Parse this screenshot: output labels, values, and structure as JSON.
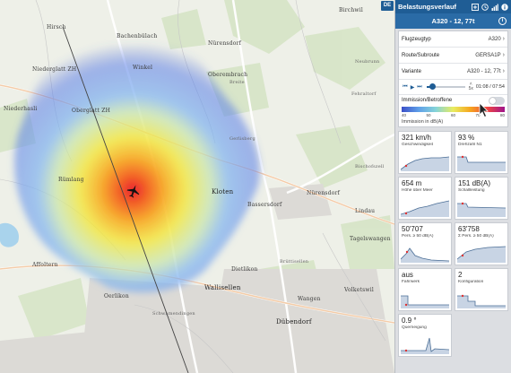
{
  "map": {
    "places": [
      {
        "name": "Hirsch",
        "cls": "small"
      },
      {
        "name": "Bachenbülach",
        "cls": ""
      },
      {
        "name": "Nürensdorf",
        "cls": ""
      },
      {
        "name": "Birchwil",
        "cls": "small"
      },
      {
        "name": "Niederglatt ZH",
        "cls": ""
      },
      {
        "name": "Winkel",
        "cls": ""
      },
      {
        "name": "Oberembrach",
        "cls": "small"
      },
      {
        "name": "Breite",
        "cls": "small"
      },
      {
        "name": "Oberglatt ZH",
        "cls": ""
      },
      {
        "name": "Niederhasli",
        "cls": ""
      },
      {
        "name": "Rümlang",
        "cls": ""
      },
      {
        "name": "Gerlisberg",
        "cls": "small"
      },
      {
        "name": "Kloten",
        "cls": "big"
      },
      {
        "name": "Bassersdorf",
        "cls": ""
      },
      {
        "name": "Nürensdorf",
        "cls": ""
      },
      {
        "name": "Lindau",
        "cls": ""
      },
      {
        "name": "Tagelswangen",
        "cls": ""
      },
      {
        "name": "Dietlikon",
        "cls": ""
      },
      {
        "name": "Wallisellen",
        "cls": "big"
      },
      {
        "name": "Brüttisellen",
        "cls": "small"
      },
      {
        "name": "Affoltern",
        "cls": ""
      },
      {
        "name": "Oerlikon",
        "cls": ""
      },
      {
        "name": "Dübendorf",
        "cls": "big"
      },
      {
        "name": "Schwamendingen",
        "cls": "small"
      },
      {
        "name": "Neubrunn",
        "cls": "small"
      },
      {
        "name": "Fehraltorf",
        "cls": "small"
      },
      {
        "name": "Bischofszell",
        "cls": "small"
      },
      {
        "name": "Volketswil",
        "cls": ""
      },
      {
        "name": "Wangen",
        "cls": ""
      }
    ],
    "lang_button": "DE"
  },
  "panel": {
    "title": "Belastungsverlauf",
    "title_icons": [
      "add-icon",
      "history-icon",
      "signal-icon",
      "info-icon"
    ],
    "flight": "A320 - 12, 77t",
    "rows": [
      {
        "label": "Flugzeugtyp",
        "value": "A320"
      },
      {
        "label": "Route/Subroute",
        "value": "GERSA1P"
      },
      {
        "label": "Variante",
        "value": "A320 - 12, 77t"
      }
    ],
    "player": {
      "speed": "5x",
      "time": "01:08 / 07:54",
      "progress": 0.14
    },
    "immission": {
      "label": "Immission/Betroffene",
      "toggle_on": false,
      "scale_ticks": [
        "40",
        "50",
        "60",
        "70",
        "80"
      ],
      "caption": "Immission in dB(A)"
    },
    "metrics": [
      {
        "value": "321 km/h",
        "label": "Geschwindigkeit"
      },
      {
        "value": "93 %",
        "label": "Drehzahl N1"
      },
      {
        "value": "654 m",
        "label": "Höhe über Meer"
      },
      {
        "value": "151 dB(A)",
        "label": "Schallleistung"
      },
      {
        "value": "50'707",
        "label": "Pers. ≥ 50 dB(A)"
      },
      {
        "value": "63'758",
        "label": "Σ Pers. ≥ 50 dB(A)"
      },
      {
        "value": "aus",
        "label": "Fahrwerk"
      },
      {
        "value": "2",
        "label": "Konfiguration"
      },
      {
        "value": "0.9 °",
        "label": "Querneigung"
      }
    ]
  }
}
